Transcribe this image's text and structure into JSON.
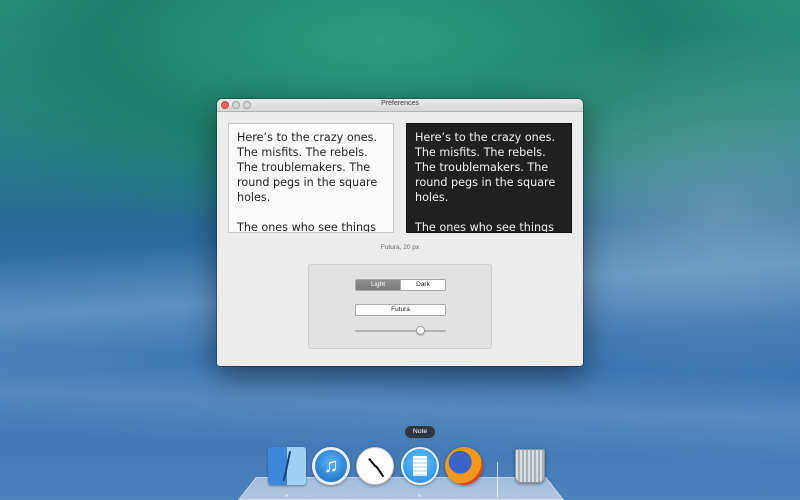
{
  "window": {
    "title": "Preferences"
  },
  "preview": {
    "light_paragraph_1": "Here’s to the crazy ones. The misfits. The rebels. The troublemakers. The round pegs in the square holes.",
    "light_paragraph_2": "The ones who see things differently. They’re not fond",
    "dark_paragraph_1": "Here’s to the crazy ones. The misfits. The rebels. The troublemakers. The round pegs in the square holes.",
    "dark_paragraph_2": "The ones who see things differently. They’re not fond"
  },
  "font_info": "Futura, 20 px",
  "settings": {
    "theme_options": [
      "Light",
      "Dark"
    ],
    "selected_theme": "Light",
    "font_button_label": "Futura",
    "font_size_slider_fraction": 0.72
  },
  "dock": {
    "tooltip": "Note",
    "apps": [
      "finder-icon",
      "itunes-icon",
      "clock-icon",
      "note-icon",
      "firefox-icon",
      "trash-icon"
    ]
  },
  "colors": {
    "close_button": "#fc605c",
    "dark_preview_bg": "#202020",
    "segment_active": "#7a7a7a"
  }
}
